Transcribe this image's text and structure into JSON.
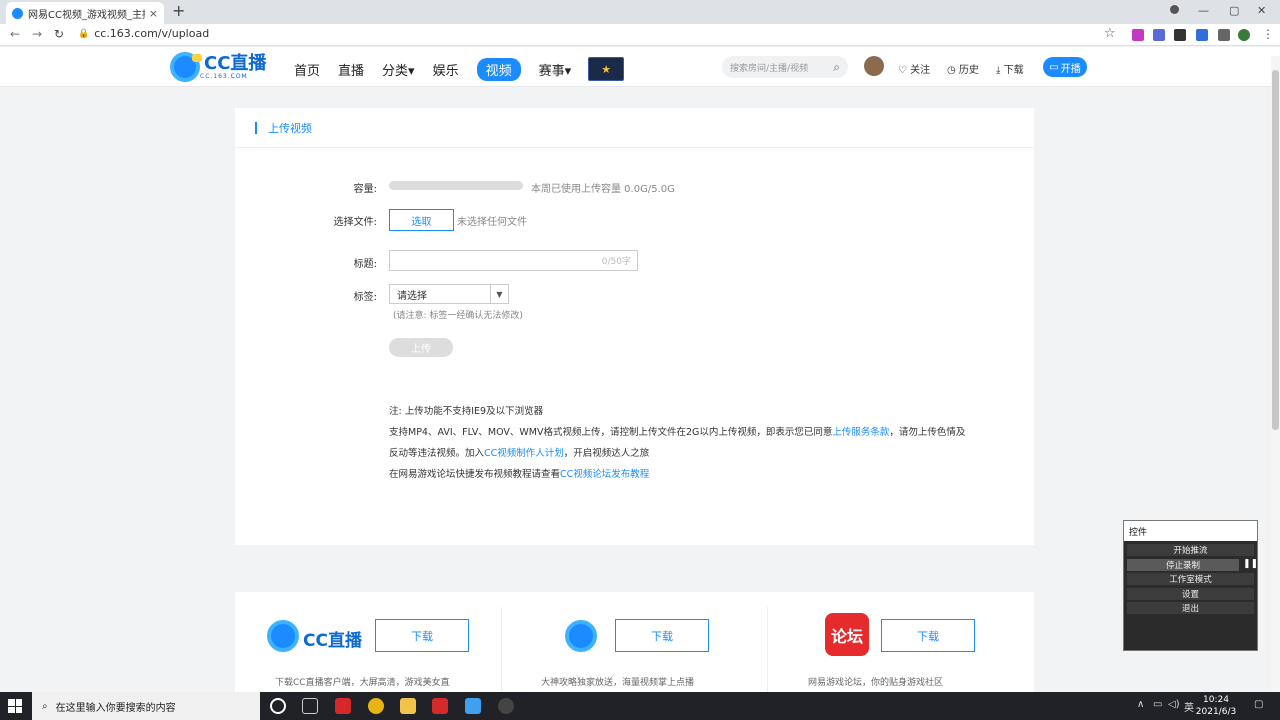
{
  "browser": {
    "tab_title": "网易CC视频_游戏视频_主播视频",
    "tab_close": "×",
    "new_tab": "+",
    "url": "cc.163.com/v/upload",
    "back": "←",
    "forward": "→",
    "reload": "↻",
    "bookmark_star": "☆",
    "win_minimize": "—",
    "win_maximize": "▢",
    "win_close": "✕"
  },
  "site": {
    "logo_text": "CC直播",
    "logo_sub": "CC.163.COM",
    "nav": [
      "首页",
      "直播",
      "分类",
      "娱乐",
      "视频",
      "赛事"
    ],
    "dropdown_marker": "▾",
    "search_placeholder": "搜索房间/主播/视频",
    "search_icon": "⌕",
    "links": {
      "follow": "关注",
      "history": "历史",
      "download": "下载"
    },
    "open_live": "开播"
  },
  "upload": {
    "section_title": "上传视频",
    "capacity_label": "容量:",
    "capacity_text": "本周已使用上传容量 0.0G/5.0G",
    "capacity_used_fraction": 0,
    "file_label": "选择文件:",
    "pick_button": "选取",
    "no_file": "未选择任何文件",
    "title_label": "标题:",
    "title_counter": "0/50字",
    "tag_label": "标签:",
    "tag_select": "请选择",
    "tag_hint": "(请注意: 标签一经确认无法修改)",
    "upload_button": "上传",
    "note_line1": "注: 上传功能不支持IE9及以下浏览器",
    "note_line2a": "支持MP4、AVI、FLV、MOV、WMV格式视频上传，请控制上传文件在2G以内上传视频，即表示您已同意",
    "note_line2_link": "上传服务条款",
    "note_line2b": "，请勿上传色情及",
    "note_line3a": "反动等违法视频。加入",
    "note_line3_link": "CC视频制作人计划",
    "note_line3b": "，开启视频达人之旅",
    "note_line4a": "在网易游戏论坛快捷发布视频教程请查看",
    "note_line4_link": "CC视频论坛发布教程"
  },
  "downloads": {
    "button": "下载",
    "col1_desc": "下载CC直播客户端，大屏高清，游戏美女直",
    "col2_desc": "大神攻略独家放送，海量视频掌上点播",
    "col3_desc": "网易游戏论坛，你的贴身游戏社区",
    "forum_logo_text": "论坛"
  },
  "recorder": {
    "title": "控件",
    "items": [
      "开始推流",
      "停止录制",
      "工作室模式",
      "设置",
      "退出"
    ],
    "pause": "❚❚"
  },
  "taskbar": {
    "search_placeholder": "在这里输入你要搜索的内容",
    "ime": "英",
    "time": "10:24",
    "date": "2021/6/3"
  },
  "colors": {
    "accent": "#1a8cff"
  }
}
